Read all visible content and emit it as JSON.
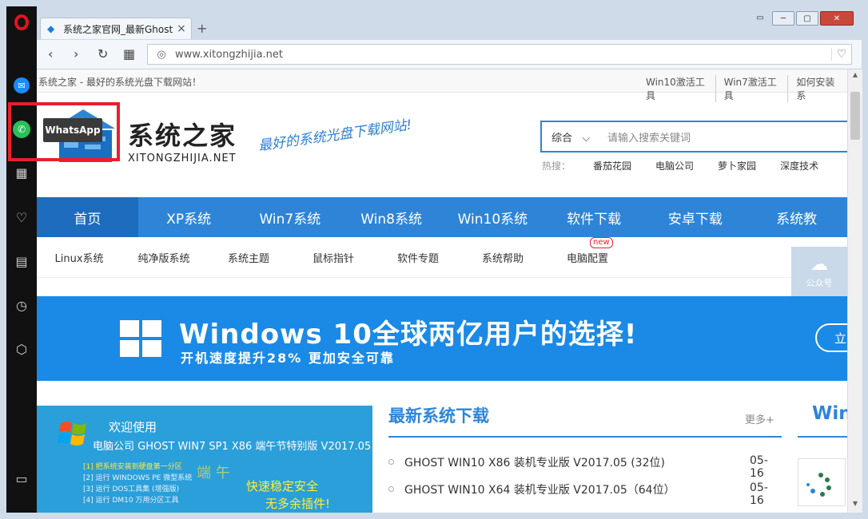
{
  "browser": {
    "tab_title": "系统之家官网_最新Ghost",
    "tab_close": "×",
    "new_tab": "+",
    "url": "www.xitongzhijia.net",
    "back": "‹",
    "forward": "›",
    "reload": "↻",
    "speed_dial": "▦",
    "globe": "◎",
    "bookmark_heart": "♡",
    "window_controls": [
      "▭",
      "─",
      "▢",
      "✕"
    ]
  },
  "sidebar": {
    "icons": [
      "opera-logo",
      "messenger-icon",
      "whatsapp-icon",
      "speed-dial-icon",
      "heart-icon",
      "news-icon",
      "history-icon",
      "extensions-icon",
      "sidebar-toggle-icon"
    ],
    "tooltip": "WhatsApp"
  },
  "page": {
    "tagline": "系统之家 - 最好的系统光盘下载网站！",
    "top_links": [
      "Win10激活工具",
      "Win7激活工具",
      "如何安装系"
    ],
    "logo_cn": "系统之家",
    "logo_en": "XITONGZHIJIA.NET",
    "slogan": "最好的系统光盘下载网站!",
    "search_category": "综合",
    "search_chevron": "⌵",
    "search_placeholder": "请输入搜索关键词",
    "hot_label": "热搜：",
    "hot_items": [
      "番茄花园",
      "电脑公司",
      "萝卜家园",
      "深度技术"
    ],
    "main_nav": [
      "首页",
      "XP系统",
      "Win7系统",
      "Win8系统",
      "Win10系统",
      "软件下载",
      "安卓下载",
      "系统教"
    ],
    "sub_nav": [
      "Linux系统",
      "纯净版系统",
      "系统主题",
      "鼠标指针",
      "软件专题",
      "系统帮助",
      "电脑配置"
    ],
    "new_badge": "new",
    "wechat_label": "公众号",
    "banner_title": "Windows 10全球两亿用户的选择!",
    "banner_subtitle": "开机速度提升28% 更加安全可靠",
    "banner_button": "立",
    "promo_welcome": "欢迎使用",
    "promo_title": "电脑公司 GHOST WIN7 SP1 X86 端午节特别版 V2017.05",
    "promo_steps": [
      "[1]  把系统安装到硬盘第一分区",
      "[2]  运行 WINDOWS PE 微型系统",
      "[3]  运行 DOS工具集 (增强版)",
      "[4]  运行 DM10 万用分区工具"
    ],
    "promo_big": "端 午",
    "promo_tag1": "快速稳定安全",
    "promo_tag2": "无多余插件!",
    "newest_heading": "最新系统下载",
    "newest_more": "更多+",
    "downloads": [
      {
        "title": "GHOST WIN10 X86 装机专业版 V2017.05 (32位)",
        "date": "05-16"
      },
      {
        "title": "GHOST WIN10 X64 装机专业版 V2017.05（64位）",
        "date": "05-16"
      }
    ],
    "right_heading": "Win"
  }
}
